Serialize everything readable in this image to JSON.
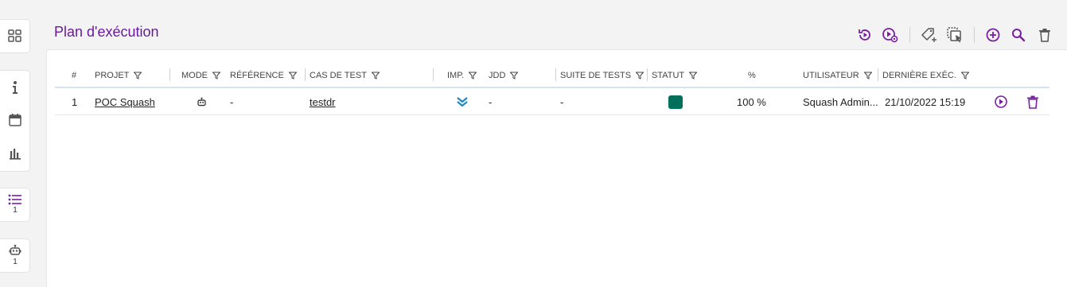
{
  "page": {
    "title": "Plan d'exécution"
  },
  "rail": {
    "items": [
      {
        "icon": "dashboard-icon"
      },
      {
        "icon": "info-icon"
      },
      {
        "icon": "calendar-icon"
      },
      {
        "icon": "bar-chart-icon"
      },
      {
        "icon": "list-icon",
        "count": "1"
      },
      {
        "icon": "robot-icon",
        "count": "1"
      }
    ]
  },
  "toolbar": {
    "icons": [
      "restore-icon",
      "play-settings-icon",
      "add-tag-icon",
      "copy-select-icon",
      "add-circle-icon",
      "search-icon",
      "delete-icon"
    ]
  },
  "table": {
    "headers": {
      "num": "#",
      "projet": "PROJET",
      "mode": "MODE",
      "reference": "RÉFÉRENCE",
      "cas": "CAS DE TEST",
      "imp": "IMP.",
      "jdd": "JDD",
      "suite": "SUITE DE TESTS",
      "statut": "STATUT",
      "pct": "%",
      "utilisateur": "UTILISATEUR",
      "derniere": "DERNIÈRE EXÉC."
    },
    "rows": [
      {
        "num": "1",
        "projet": "POC Squash",
        "mode_icon": "robot-icon",
        "reference": "-",
        "cas": "testdr",
        "imp_icon": "double-chevron-down-icon",
        "jdd": "-",
        "suite": "-",
        "statut_color": "#00705b",
        "pct": "100 %",
        "utilisateur": "Squash Admin...",
        "derniere": "21/10/2022 15:19"
      }
    ]
  },
  "colors": {
    "accent": "#6a1b9a",
    "status_ok": "#00705b",
    "importance": "#1e88c7"
  }
}
